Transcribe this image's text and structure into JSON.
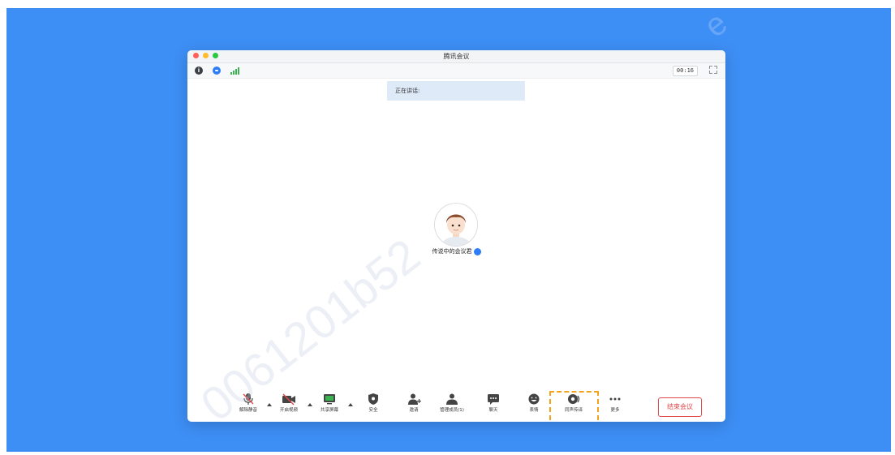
{
  "window": {
    "title": "腾讯会议"
  },
  "infobar": {
    "timer": "00:16",
    "info_icon": "i"
  },
  "speaking": {
    "label": "正在讲话:"
  },
  "participant": {
    "name": "传说中的会议君",
    "badge": ""
  },
  "toolbar": {
    "items": [
      {
        "label": "解除静音",
        "icon": "muted-mic-icon"
      },
      {
        "label": "开启视频",
        "icon": "video-off-icon"
      },
      {
        "label": "共享屏幕",
        "icon": "share-screen-icon"
      },
      {
        "label": "安全",
        "icon": "security-icon"
      },
      {
        "label": "邀请",
        "icon": "invite-icon"
      },
      {
        "label": "管理成员(1)",
        "icon": "members-icon"
      },
      {
        "label": "聊天",
        "icon": "chat-icon"
      },
      {
        "label": "表情",
        "icon": "emoji-icon"
      },
      {
        "label": "同声传译",
        "icon": "interpretation-icon"
      },
      {
        "label": "更多",
        "icon": "more-icon"
      }
    ],
    "end_label": "结束会议"
  },
  "watermark": {
    "main": "0061201b52",
    "corner": "e"
  },
  "colors": {
    "background": "#3d8ef5",
    "accent": "#2e7cf6",
    "end_button": "#e0484a",
    "highlight": "#f2a31b",
    "speaking_bg": "#dfeaf9"
  }
}
